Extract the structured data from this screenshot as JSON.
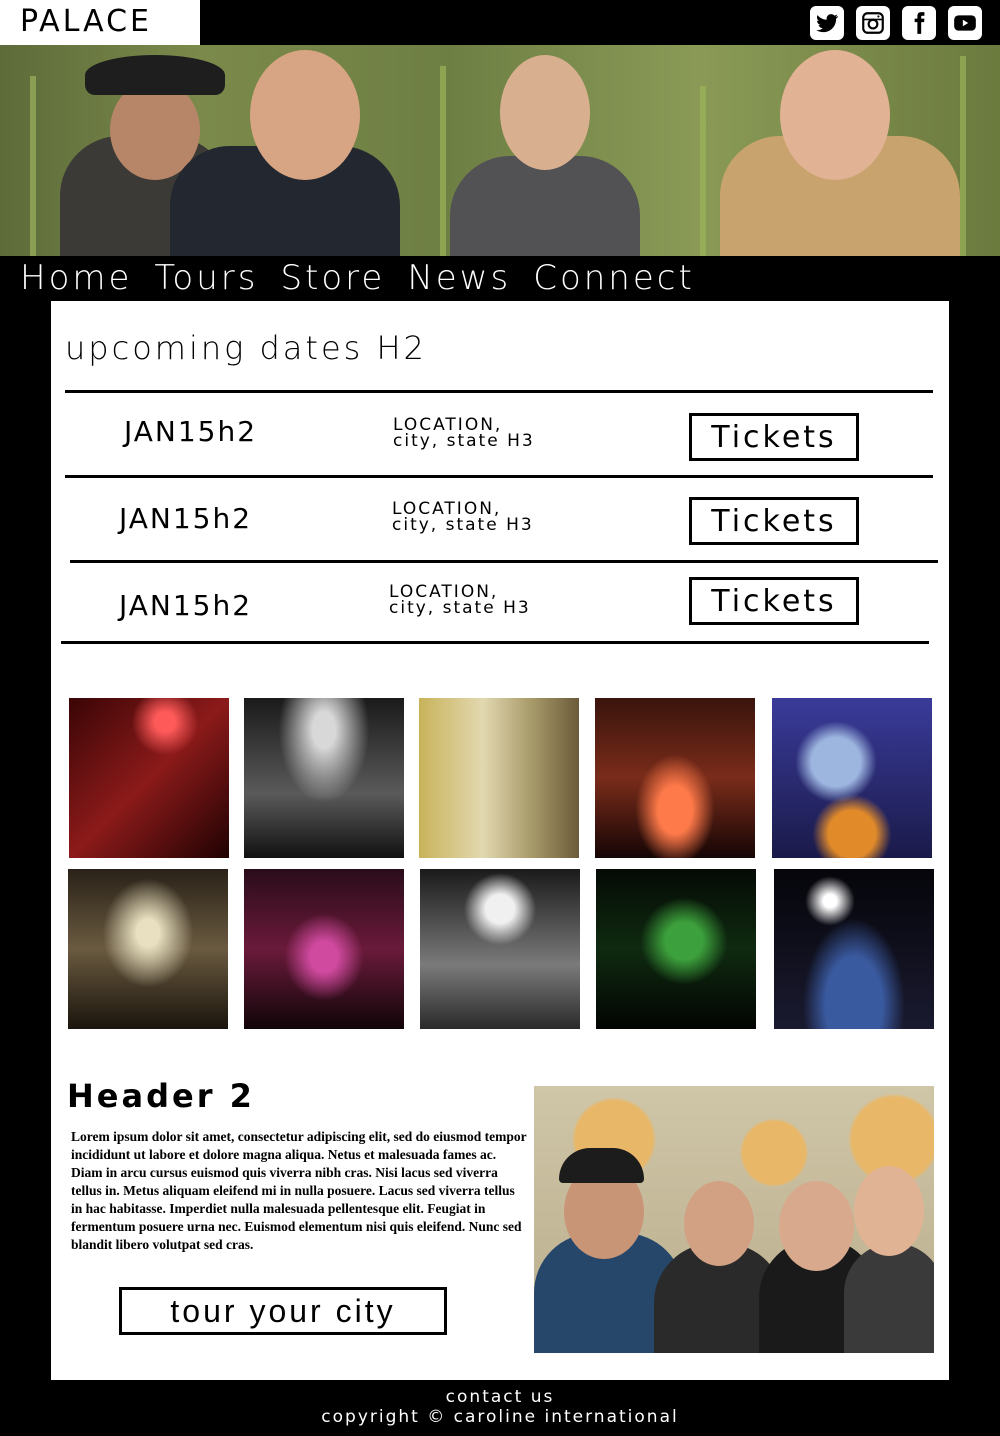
{
  "site": {
    "logo": "PALACE",
    "social_icons": [
      "twitter-icon",
      "instagram-icon",
      "facebook-icon",
      "youtube-icon"
    ]
  },
  "nav": {
    "items": [
      "Home",
      "Tours",
      "Store",
      "News",
      "Connect"
    ]
  },
  "upcoming": {
    "title": "upcoming dates H2",
    "rows": [
      {
        "date": "JAN15h2",
        "location_line1": "LOCATION,",
        "location_line2": "city, state H3",
        "ticket_label": "Tickets"
      },
      {
        "date": "JAN15h2",
        "location_line1": "LOCATION,",
        "location_line2": "city, state H3",
        "ticket_label": "Tickets"
      },
      {
        "date": "JAN15h2",
        "location_line1": "LOCATION,",
        "location_line2": "city, state H3",
        "ticket_label": "Tickets"
      }
    ]
  },
  "gallery": {
    "photos": [
      "concert-photo-1",
      "concert-photo-2",
      "concert-photo-3",
      "concert-photo-4",
      "concert-photo-5",
      "concert-photo-6",
      "concert-photo-7",
      "concert-photo-8",
      "concert-photo-9",
      "concert-photo-10"
    ]
  },
  "feature": {
    "header": "Header 2",
    "body": "Lorem ipsum dolor sit amet, consectetur adipiscing elit, sed do eiusmod tempor incididunt ut labore et dolore magna aliqua. Netus et malesuada fames ac. Diam in arcu cursus euismod quis viverra nibh cras. Nisi lacus sed viverra tellus in. Metus aliquam eleifend mi in nulla posuere. Lacus sed viverra tellus in hac habitasse. Imperdiet nulla malesuada pellentesque elit. Feugiat in fermentum posuere urna nec. Euismod elementum nisi quis eleifend. Nunc sed blandit libero volutpat sed cras.",
    "button_label": "tour your city"
  },
  "footer": {
    "contact": "contact us",
    "copyright": "copyright ©  caroline international"
  },
  "colors": {
    "background": "#000000",
    "panel": "#ffffff",
    "text": "#000000"
  }
}
